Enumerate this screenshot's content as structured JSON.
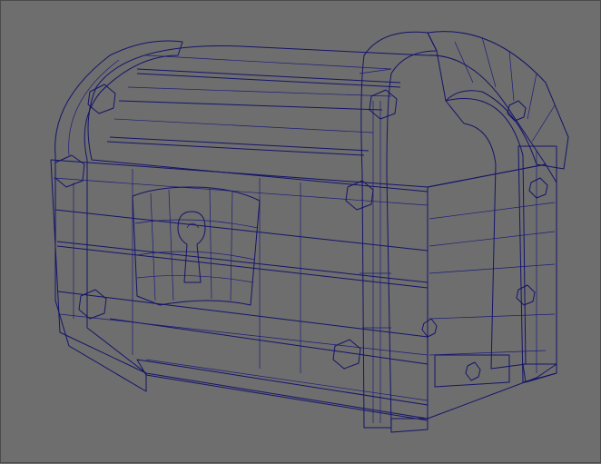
{
  "viewport": {
    "background": "#6e6e6e",
    "mesh_fill_light": "#a9a9a9",
    "mesh_fill_mid": "#8f8f8f",
    "mesh_fill_dark": "#6a6a6a",
    "wire_color": "#14146a"
  },
  "model": {
    "object": "treasure-chest",
    "display_mode": "wireframe-on-shaded"
  }
}
